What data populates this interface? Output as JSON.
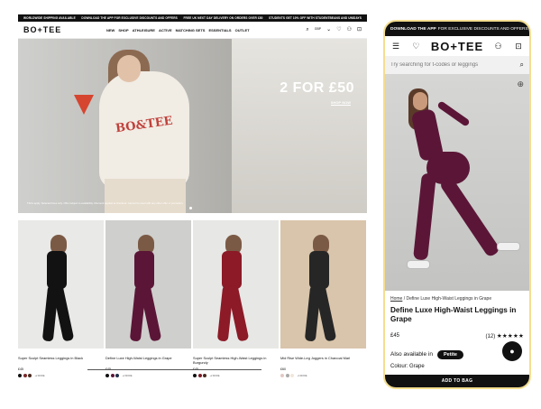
{
  "desktop": {
    "promo": [
      "WORLDWIDE SHIPPING AVAILABLE",
      "DOWNLOAD THE APP FOR EXCLUSIVE DISCOUNTS AND OFFERS",
      "FREE UK NEXT DAY DELIVERY ON ORDERS OVER £80",
      "STUDENTS GET 10% OFF WITH STUDENTBEANS AND UNIDAYS"
    ],
    "logo": "BO+TEE",
    "nav": [
      "NEW",
      "SHOP",
      "ATHLEISURE",
      "ACTIVE",
      "MATCHING SETS",
      "ESSENTIALS",
      "OUTLET"
    ],
    "currency": "GBP",
    "hero": {
      "deal": "2 FOR £50",
      "cta": "SHOP NOW",
      "print": "BO&TEE",
      "fine": "T&Cs apply. Selected lines only. Offer subject to availability. Discount applied at checkout. Cannot be used with any other offer or promotion."
    },
    "products": [
      {
        "name": "Super Sculpt Seamless Leggings in Black",
        "price": "£45",
        "more": "+2 MORE",
        "colors": [
          "#111111",
          "#7a2a2a",
          "#4b2b1f"
        ],
        "bg": "#e9e9e7",
        "garment": "#121212",
        "top": "#121212"
      },
      {
        "name": "Define Luxe High-Waist Leggings in Grape",
        "price": "£45",
        "more": "+2 MORE",
        "colors": [
          "#111111",
          "#5b1637",
          "#1e2f4a"
        ],
        "bg": "#cfcfcd",
        "garment": "#5b1637",
        "top": "#5b1637"
      },
      {
        "name": "Super Sculpt Seamless High-Waist Leggings in Burgundy",
        "price": "£45",
        "more": "+2 MORE",
        "colors": [
          "#111111",
          "#7a1a24",
          "#4b2b1f"
        ],
        "bg": "#e7e7e5",
        "garment": "#8c1a27",
        "top": "#8c1a27"
      },
      {
        "name": "Mid Rise Wide-Leg Joggers in Charcoal Marl",
        "price": "£60",
        "more": "+3 MORE",
        "colors": [
          "#e3c8c4",
          "#a9a9a9",
          "#f1e6da"
        ],
        "bg": "#d9c5ab",
        "garment": "#262626",
        "top": "#262626"
      }
    ]
  },
  "phone": {
    "promo_bold": "DOWNLOAD THE APP",
    "promo_rest": "FOR EXCLUSIVE DISCOUNTS AND OFFERS",
    "logo": "BO+TEE",
    "search_placeholder": "Try searching for t-codes or leggings",
    "breadcrumb_home": "Home",
    "breadcrumb_rest": "/ Define Luxe High-Waist Leggings in Grape",
    "title": "Define Luxe High-Waist Leggings in Grape",
    "price": "£45",
    "review_count": "(12)",
    "stars": "★★★★★",
    "available_label": "Also available in",
    "available_option": "Petite",
    "colour_label": "Colour: Grape",
    "add_to_bag": "ADD TO BAG"
  }
}
